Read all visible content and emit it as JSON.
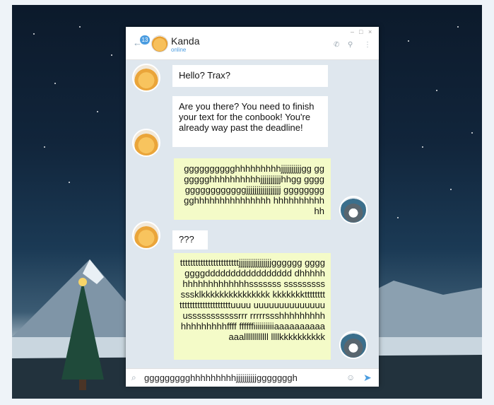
{
  "window": {
    "controls": [
      "–",
      "□",
      "×"
    ]
  },
  "header": {
    "unread_count": "13",
    "contact_name": "Kanda",
    "contact_status": "online",
    "icons": [
      "phone-icon",
      "search-icon",
      "more-vert-icon"
    ]
  },
  "messages": [
    {
      "from": "Kanda",
      "text": "Hello? Trax?"
    },
    {
      "from": "Kanda",
      "text": "Are you there? You need to finish your text for the conbook! You're already way past the deadline!"
    },
    {
      "from": "me",
      "text": "gggggggggghhhhhhhhhjjjjjjjjjjgg ggggggghhhhhhhhhhjjjjjjjjjjhhgg ggggggggggggggggjjjjjjjjjjjjjjjjj gggggggggghhhhhhhhhhhhhhh hhhhhhhhhhhh"
    },
    {
      "from": "Kanda",
      "text": "???"
    },
    {
      "from": "me",
      "text": "tttttttttttttttttttttttjjjjjjjjjjjjjjjjgggggg ggggggggddddddddddddddddd dhhhhhhhhhhhhhhhhhhsssssss ssssssssssssklkkkkkkkkkkkkkkk kkkkkkkttttttttttttttttttttttttttttuuuu uuuuuuuuuuuuuuusssssssssssrrr rrrrrssshhhhhhhhhhhhhhhhhhffff ffffffiiiiiiiiiiaaaaaaaaaaaaallllllllllll llllkkkkkkkkkk"
    }
  ],
  "composer": {
    "draft": "ggggggggghhhhhhhhhjjjjjjjjjjgggggggh"
  },
  "colors": {
    "incoming_bubble": "#ffffff",
    "outgoing_bubble": "#f4fbc8",
    "accent": "#4a9ce0"
  }
}
